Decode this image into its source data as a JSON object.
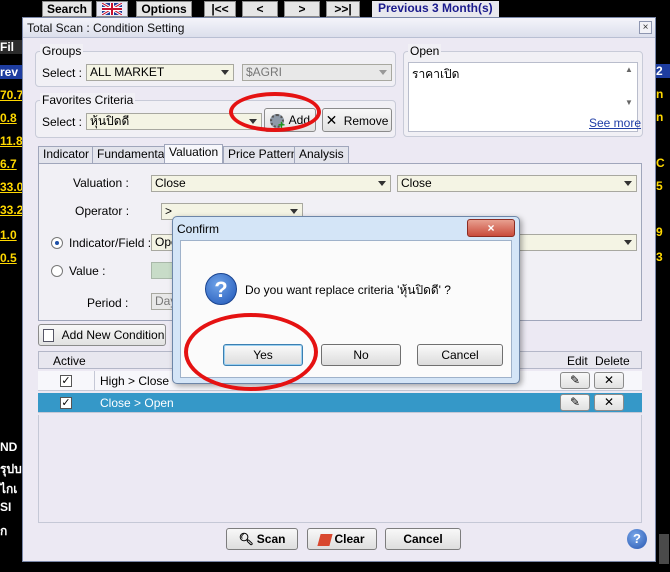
{
  "toolbar": {
    "search_label": "Search",
    "options_label": "Options",
    "first_label": "|<<",
    "prev_label": "<",
    "next_label": ">",
    "last_label": ">>|",
    "period_label": "Previous 3 Month(s)"
  },
  "background": {
    "left_items": [
      "Fil",
      "rev",
      "70.7",
      "0.8",
      "11.8",
      "6.7",
      "33.0",
      "33.2",
      "1.0",
      "0.5",
      "ND",
      "รุปบ",
      "ไกเ",
      "SI",
      "ก"
    ],
    "right_items": [
      "2",
      "n",
      "n",
      "C",
      "5",
      "9",
      "3"
    ]
  },
  "window": {
    "title": "Total Scan : Condition Setting",
    "close_glyph": "×",
    "groups": {
      "legend": "Groups",
      "select_label": "Select :",
      "market_value": "ALL MARKET",
      "sector_value": "$AGRI"
    },
    "favorites": {
      "legend": "Favorites Criteria",
      "select_label": "Select :",
      "value": "หุ้นปิดดี",
      "add_label": "Add",
      "remove_label": "Remove"
    },
    "open": {
      "legend": "Open",
      "text": "ราคาเปิด",
      "see_more": "See more"
    },
    "tabs": [
      "Indicator",
      "Fundamental",
      "Valuation",
      "Price Pattern",
      "Analysis"
    ],
    "active_tab": "Valuation",
    "valuation": {
      "label": "Valuation :",
      "left_value": "Close",
      "right_value": "Close",
      "operator_label": "Operator :",
      "operator_value": ">",
      "indicator_label": "Indicator/Field :",
      "indicator_value": "Ope",
      "value_label": "Value :",
      "period_label": "Period :",
      "period_value": "Day"
    },
    "add_condition_label": "Add New Condition",
    "grid": {
      "col_active": "Active",
      "col_edit": "Edit",
      "col_delete": "Delete",
      "rows": [
        {
          "checked": "✓",
          "condition": "High > Close"
        },
        {
          "checked": "✓",
          "condition": "Close > Open"
        }
      ]
    },
    "buttons": {
      "scan": "Scan",
      "clear": "Clear",
      "cancel": "Cancel",
      "help": "?"
    }
  },
  "confirm": {
    "title": "Confirm",
    "close_glyph": "×",
    "icon_glyph": "?",
    "message": "Do you want replace criteria 'หุ้นปิดดี' ?",
    "yes_label": "Yes",
    "no_label": "No",
    "cancel_label": "Cancel"
  },
  "colors": {
    "accent_oval": "#e51212",
    "background_ticker": "#ffd800",
    "selected_row": "#3598c8"
  }
}
